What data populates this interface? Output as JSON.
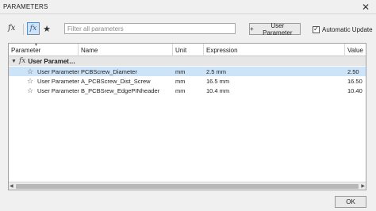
{
  "window": {
    "title": "PARAMETERS",
    "close_glyph": "✕"
  },
  "toolbar": {
    "fx_icon_glyph": "fx",
    "filter_placeholder": "Filter all parameters",
    "add_button_label": "User Parameter",
    "add_button_icon": "+",
    "auto_update_label": "Automatic Update",
    "auto_update_checked": true,
    "check_glyph": "✓"
  },
  "table": {
    "columns": [
      "Parameter",
      "Name",
      "Unit",
      "Expression",
      "Value"
    ],
    "group": {
      "label": "User Paramet…",
      "expanded": true
    },
    "rows": [
      {
        "parameter": "User Parameter",
        "name": "PCBScrew_Diameter",
        "unit": "mm",
        "expression": "2.5 mm",
        "value": "2.50",
        "selected": true
      },
      {
        "parameter": "User Parameter",
        "name": "A_PCBScrew_Dist_Screw",
        "unit": "mm",
        "expression": "16.5 mm",
        "value": "16.50",
        "selected": false
      },
      {
        "parameter": "User Parameter",
        "name": "B_PCBSrew_EdgePINheader",
        "unit": "mm",
        "expression": "10.4 mm",
        "value": "10.40",
        "selected": false
      }
    ]
  },
  "footer": {
    "ok_label": "OK"
  },
  "colors": {
    "selected_row": "#cce3f8",
    "group_row": "#e6e6e6",
    "active_filter": "#cfe2f6"
  }
}
